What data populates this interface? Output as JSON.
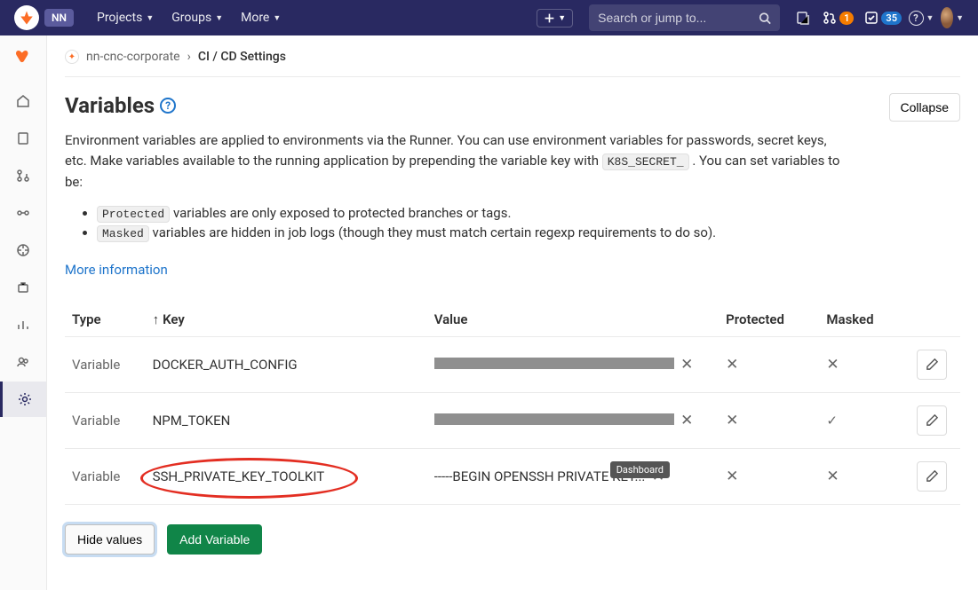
{
  "topbar": {
    "logo_text": "NN",
    "nav": {
      "projects": "Projects",
      "groups": "Groups",
      "more": "More"
    },
    "search_placeholder": "Search or jump to...",
    "mr_count": "1",
    "todo_count": "35"
  },
  "breadcrumb": {
    "project": "nn-cnc-corporate",
    "sep": "›",
    "page": "CI / CD Settings"
  },
  "section": {
    "title": "Variables",
    "collapse": "Collapse",
    "desc_1": "Environment variables are applied to environments via the Runner. You can use environment variables for passwords, secret keys, etc. Make variables available to the running application by prepending the variable key with ",
    "code": "K8S_SECRET_",
    "desc_2": ". You can set variables to be:",
    "bullet1_code": "Protected",
    "bullet1_text": " variables are only exposed to protected branches or tags.",
    "bullet2_code": "Masked",
    "bullet2_text": " variables are hidden in job logs (though they must match certain regexp requirements to do so).",
    "more_info": "More information"
  },
  "table": {
    "headers": {
      "type": "Type",
      "key": "Key",
      "value": "Value",
      "protected": "Protected",
      "masked": "Masked"
    },
    "rows": [
      {
        "type": "Variable",
        "key": "DOCKER_AUTH_CONFIG",
        "value_masked": true,
        "value": "",
        "protected": false,
        "masked": false
      },
      {
        "type": "Variable",
        "key": "NPM_TOKEN",
        "value_masked": true,
        "value": "",
        "protected": false,
        "masked": true
      },
      {
        "type": "Variable",
        "key": "SSH_PRIVATE_KEY_TOOLKIT",
        "value_masked": false,
        "value": "-----BEGIN OPENSSH PRIVATE KEY...",
        "protected": false,
        "masked": false
      }
    ]
  },
  "actions": {
    "hide": "Hide values",
    "add": "Add Variable"
  },
  "tooltip": "Dashboard"
}
